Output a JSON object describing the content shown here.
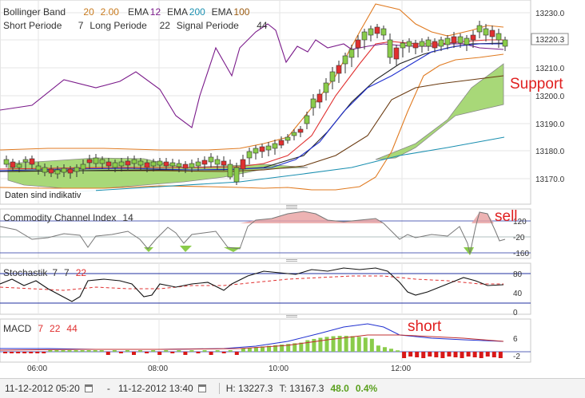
{
  "colors": {
    "red": "#e03030",
    "green": "#5aa01e",
    "teal": "#1a8fb0",
    "brown": "#9a5a10",
    "purple": "#7a1a8a",
    "orange": "#e07a20",
    "blue": "#2030d0"
  },
  "legend": {
    "row1": [
      {
        "label": "Bollinger Band",
        "color": "#333333"
      },
      {
        "label": "20",
        "color": "#c87a1e"
      },
      {
        "label": "2.00",
        "color": "#c87a1e"
      },
      {
        "label": "EMA",
        "color": "#333333"
      },
      {
        "label": "12",
        "color": "#7a1a8a"
      },
      {
        "label": "EMA",
        "color": "#333333"
      },
      {
        "label": "200",
        "color": "#1a8fb0"
      },
      {
        "label": "EMA",
        "color": "#333333"
      },
      {
        "label": "100",
        "color": "#9a5a10"
      }
    ],
    "row2": [
      {
        "label": "Short Periode",
        "color": "#333333"
      },
      {
        "label": "7",
        "color": "#333333"
      },
      {
        "label": "Long Periode",
        "color": "#333333"
      },
      {
        "label": "22",
        "color": "#333333"
      },
      {
        "label": "Signal Periode",
        "color": "#333333"
      },
      {
        "label": "44",
        "color": "#333333"
      }
    ]
  },
  "main": {
    "price_ticks": [
      "13230.0",
      "13220.0",
      "13210.0",
      "13200.0",
      "13190.0",
      "13180.0",
      "13170.0"
    ],
    "current_price": "13220.3",
    "note": "Daten sind indikativ",
    "annotation": "Support"
  },
  "cci": {
    "title": "Commodity Channel Index",
    "period": "14",
    "ticks": [
      "120",
      "-20",
      "-160"
    ],
    "annotation": "sell"
  },
  "stoch": {
    "title": "Stochastik",
    "p1": "7",
    "p2": "7",
    "p3": "22",
    "ticks": [
      "80",
      "40",
      "0"
    ]
  },
  "macd": {
    "title": "MACD",
    "p1": "7",
    "p2": "22",
    "p3": "44",
    "ticks": [
      "6",
      "-2"
    ],
    "annotation": "short"
  },
  "time_axis": [
    "06:00",
    "08:00",
    "10:00",
    "12:00"
  ],
  "footer": {
    "from": "11-12-2012 05:20",
    "dash": "-",
    "to": "11-12-2012 13:40",
    "high": "H: 13227.3",
    "low": "T: 13167.3",
    "change": "48.0",
    "change_pct": "0.4%"
  }
}
